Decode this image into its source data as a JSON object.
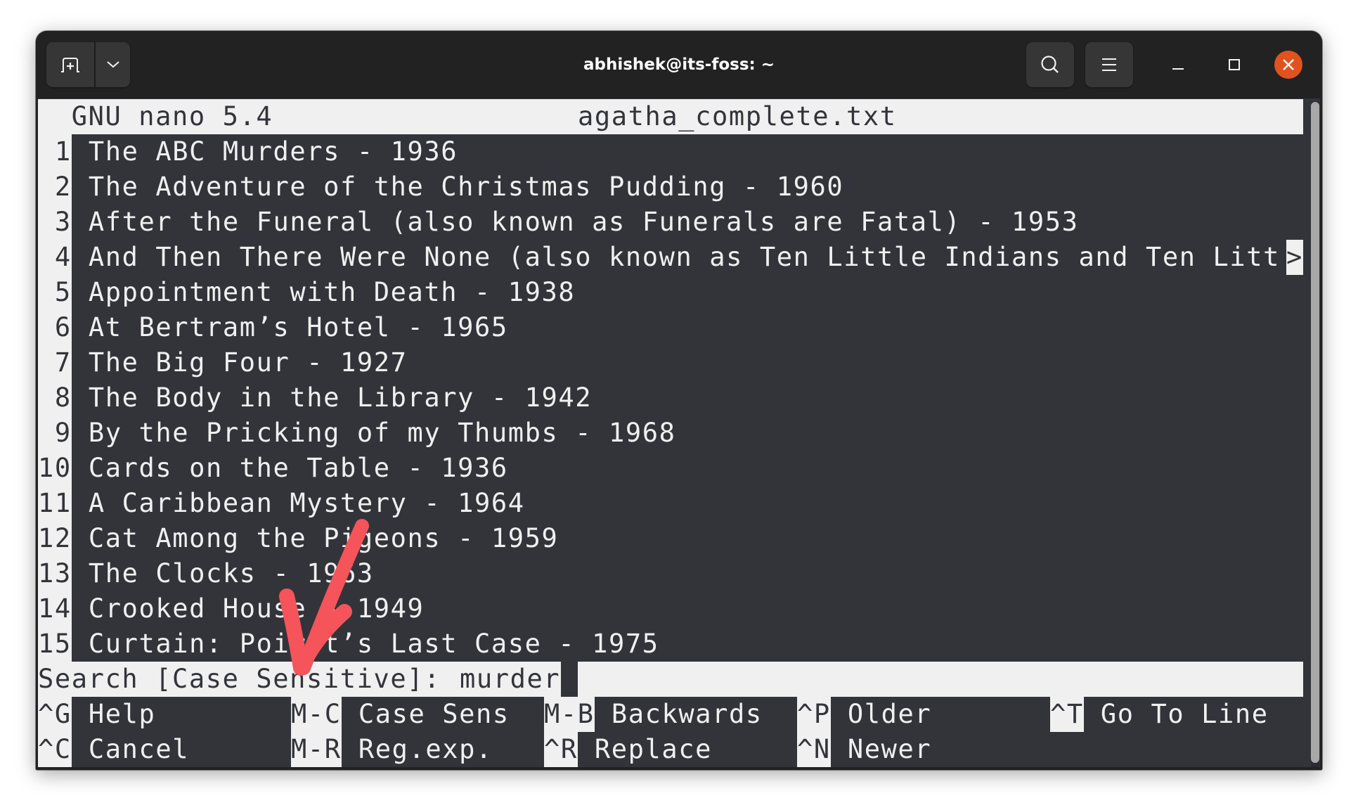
{
  "window": {
    "title": "abhishek@its-foss: ~",
    "buttons": {
      "new_tab_icon": "new-tab-icon",
      "dropdown_icon": "chevron-down-icon",
      "search_icon": "search-icon",
      "menu_icon": "hamburger-menu-icon",
      "minimize_icon": "minimize-icon",
      "maximize_icon": "maximize-icon",
      "close_icon": "close-icon"
    },
    "close_color": "#e2521e"
  },
  "nano": {
    "header_left": "  GNU nano 5.4",
    "header_filename": "agatha_complete.txt",
    "lines": [
      {
        "num": " 1",
        "text": " The ABC Murders - 1936"
      },
      {
        "num": " 2",
        "text": " The Adventure of the Christmas Pudding - 1960"
      },
      {
        "num": " 3",
        "text": " After the Funeral (also known as Funerals are Fatal) - 1953"
      },
      {
        "num": " 4",
        "text": " And Then There Were None (also known as Ten Little Indians and Ten Litt"
      },
      {
        "num": " 5",
        "text": " Appointment with Death - 1938"
      },
      {
        "num": " 6",
        "text": " At Bertram’s Hotel - 1965"
      },
      {
        "num": " 7",
        "text": " The Big Four - 1927"
      },
      {
        "num": " 8",
        "text": " The Body in the Library - 1942"
      },
      {
        "num": " 9",
        "text": " By the Pricking of my Thumbs - 1968"
      },
      {
        "num": "10",
        "text": " Cards on the Table - 1936"
      },
      {
        "num": "11",
        "text": " A Caribbean Mystery - 1964"
      },
      {
        "num": "12",
        "text": " Cat Among the Pigeons - 1959"
      },
      {
        "num": "13",
        "text": " The Clocks - 1963"
      },
      {
        "num": "14",
        "text": " Crooked House - 1949"
      },
      {
        "num": "15",
        "text": " Curtain: Poirot’s Last Case - 1975"
      }
    ],
    "overflow_marker": ">",
    "search_prompt": "Search [Case Sensitive]: ",
    "search_value": "murder",
    "shortcuts_row1": [
      {
        "key": "^G",
        "label": " Help"
      },
      {
        "key": "M-C",
        "label": " Case Sens"
      },
      {
        "key": "M-B",
        "label": " Backwards"
      },
      {
        "key": "^P",
        "label": " Older"
      },
      {
        "key": "^T",
        "label": " Go To Line"
      }
    ],
    "shortcuts_row2": [
      {
        "key": "^C",
        "label": " Cancel"
      },
      {
        "key": "M-R",
        "label": " Reg.exp."
      },
      {
        "key": "^R",
        "label": " Replace"
      },
      {
        "key": "^N",
        "label": " Newer"
      }
    ]
  },
  "annotation": {
    "type": "arrow",
    "color": "#f5545a",
    "points_to": "search-prompt"
  },
  "colors": {
    "terminal_bg": "#33343a",
    "terminal_fg": "#f0f0f0",
    "titlebar_bg": "#222222"
  }
}
